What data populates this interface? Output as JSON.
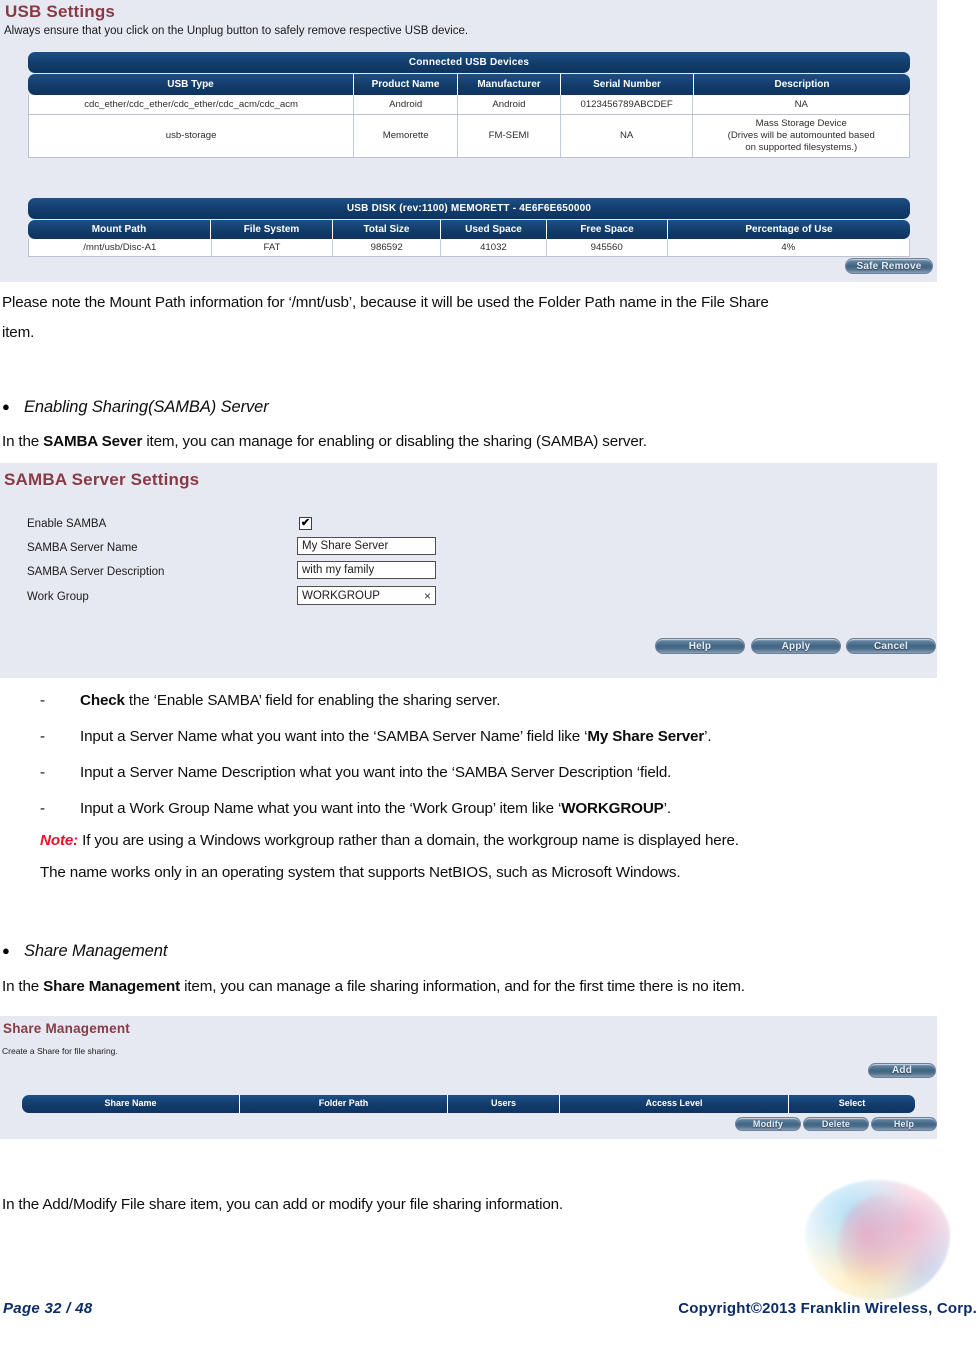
{
  "usb_panel": {
    "title": "USB Settings",
    "subtitle": "Always ensure that you click on the Unplug button to safely remove respective USB device.",
    "connected_devices": {
      "band_title": "Connected USB Devices",
      "columns": [
        "USB Type",
        "Product Name",
        "Manufacturer",
        "Serial Number",
        "Description"
      ],
      "rows": [
        {
          "usb_type": "cdc_ether/cdc_ether/cdc_ether/cdc_acm/cdc_acm",
          "product_name": "Android",
          "manufacturer": "Android",
          "serial_number": "0123456789ABCDEF",
          "description": "NA"
        },
        {
          "usb_type": "usb-storage",
          "product_name": "Memorette",
          "manufacturer": "FM-SEMI",
          "serial_number": "NA",
          "description": "Mass Storage Device\n(Drives will be automounted based\non supported filesystems.)"
        }
      ]
    },
    "usb_disk": {
      "band_title": "USB DISK (rev:1100) MEMORETT - 4E6F6E650000",
      "columns": [
        "Mount Path",
        "File System",
        "Total Size",
        "Used Space",
        "Free Space",
        "Percentage of Use"
      ],
      "rows": [
        {
          "mount_path": "/mnt/usb/Disc-A1",
          "file_system": "FAT",
          "total_size": "986592",
          "used_space": "41032",
          "free_space": "945560",
          "percentage_of_use": "4%"
        }
      ],
      "safe_remove_label": "Safe Remove"
    }
  },
  "body": {
    "mount_note_line1": "Please note the Mount Path information for ‘/mnt/usb’, because it will be used the Folder Path name in the File Share",
    "mount_note_line2": "item.",
    "bullet_samba": "Enabling Sharing(SAMBA) Server",
    "samba_intro_a": "In the ",
    "samba_intro_b": "SAMBA Sever",
    "samba_intro_c": " item, you can manage for enabling or disabling the sharing (SAMBA) server.",
    "dash_mark": "-",
    "bullet_glyph": "●",
    "steps": [
      {
        "pre": "",
        "bold": "Check",
        "post": " the ‘Enable SAMBA’ field for enabling the sharing server."
      },
      {
        "pre": "Input a Server Name what you want into the ‘SAMBA Server Name’ field like ‘",
        "bold": "My Share Server",
        "post": "’."
      },
      {
        "pre": "Input a Server Name Description what you want into the ‘SAMBA Server Description ‘field.",
        "bold": "",
        "post": ""
      },
      {
        "pre": "Input a Work Group Name what you want into the ‘Work Group’ item like ‘",
        "bold": "WORKGROUP",
        "post": "’."
      }
    ],
    "note_label": "Note:",
    "note_line1": " If you are using a Windows workgroup rather than a domain, the workgroup name is displayed here.",
    "note_line2": "The name works only in an operating system that supports NetBIOS, such as Microsoft Windows.",
    "bullet_share": "Share Management",
    "share_intro_a": "In the ",
    "share_intro_b": "Share Management",
    "share_intro_c": " item, you can manage a file sharing information, and for the first time there is no item.",
    "add_modify_line": "In the Add/Modify File share item, you can add or modify your file sharing information."
  },
  "samba_panel": {
    "title": "SAMBA Server Settings",
    "fields": [
      {
        "label": "Enable SAMBA",
        "type": "checkbox",
        "checked": true,
        "check_glyph": "✔"
      },
      {
        "label": "SAMBA Server Name",
        "type": "text",
        "value": "My Share Server"
      },
      {
        "label": "SAMBA Server Description",
        "type": "text",
        "value": "with my family"
      },
      {
        "label": "Work Group",
        "type": "text",
        "value": "WORKGROUP",
        "clear_glyph": "×"
      }
    ],
    "buttons": [
      "Help",
      "Apply",
      "Cancel"
    ]
  },
  "share_panel": {
    "title": "Share Management",
    "subtitle": "Create a Share for file sharing.",
    "add_label": "Add",
    "columns": [
      "Share Name",
      "Folder Path",
      "Users",
      "Access Level",
      "Select"
    ],
    "rows": [],
    "footer_buttons": [
      "Modify",
      "Delete",
      "Help"
    ]
  },
  "footer": {
    "page": "Page  32  /  48",
    "copyright": "Copyright©2013  Franklin  Wireless, Corp."
  },
  "colors": {
    "panel_bg": "#e6e9f2",
    "table_header_blue": "#123c6b",
    "panel_title_red": "#8a3a44",
    "note_red": "#e8112d",
    "footer_blue": "#0b2c66"
  }
}
